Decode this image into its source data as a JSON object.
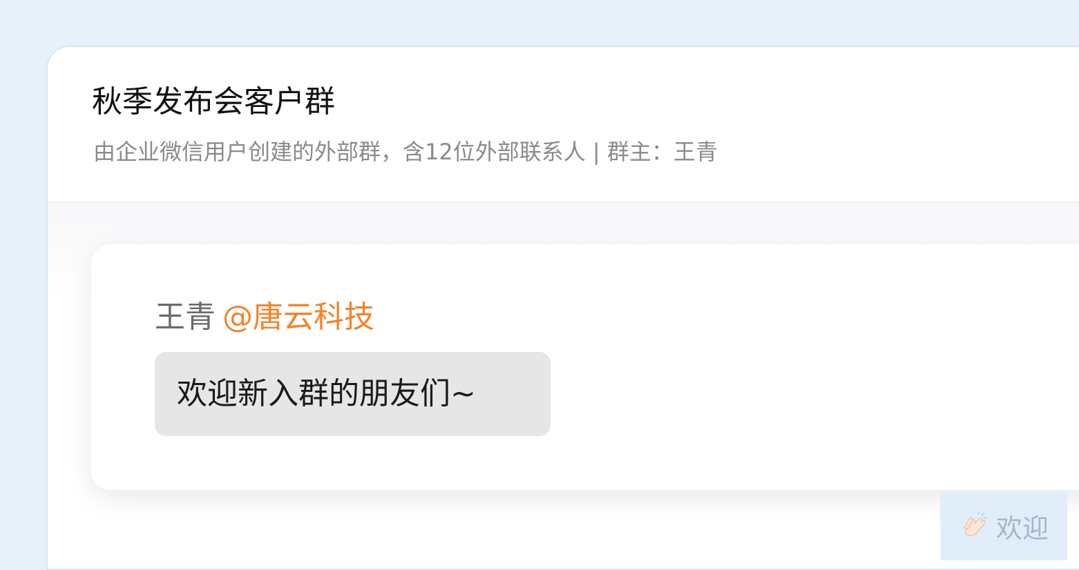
{
  "group": {
    "title": "秋季发布会客户群",
    "subtitle": "由企业微信用户创建的外部群，含12位外部联系人 | 群主：王青"
  },
  "message": {
    "sender_name": "王青",
    "sender_corp": "@唐云科技",
    "text": "欢迎新入群的朋友们~"
  },
  "welcome_button": {
    "icon": "clapping-hands-icon",
    "label": "欢迎"
  },
  "colors": {
    "background": "#e8f0fa",
    "corp_accent": "#f3832a",
    "bubble": "#e6e6e6",
    "welcome_button_bg": "#e2edfa"
  }
}
